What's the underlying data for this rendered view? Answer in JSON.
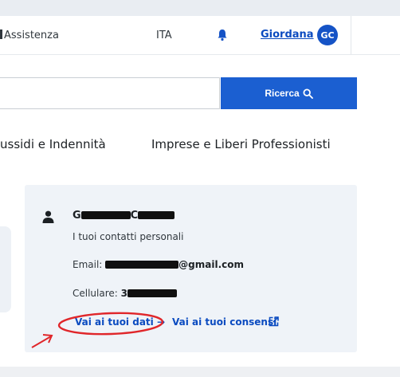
{
  "header": {
    "assistance_label": "Assistenza",
    "language": "ITA",
    "user_name": "Giordana",
    "avatar_initials": "GC"
  },
  "search": {
    "value": "",
    "button_label": "Ricerca"
  },
  "nav": {
    "items": [
      {
        "label": "ussidi e Indennità"
      },
      {
        "label": "Imprese e Liberi Professionisti"
      }
    ]
  },
  "contact_card": {
    "name_first_letter": "G",
    "name_second_letter": "C",
    "subtitle": "I tuoi contatti personali",
    "email_label": "Email:",
    "email_suffix": "@gmail.com",
    "phone_label": "Cellulare:",
    "phone_prefix": "3",
    "link_data": "Vai ai tuoi dati →",
    "link_consents": "Vai ai tuoi consensi"
  },
  "icons": {
    "bell": "bell-icon",
    "search": "search-icon",
    "person": "person-icon",
    "external_link": "external-link-icon"
  },
  "colors": {
    "primary": "#1b5fd1",
    "link": "#0b4bc0",
    "card_bg": "#eff3f8",
    "annotation": "#e0262a"
  }
}
